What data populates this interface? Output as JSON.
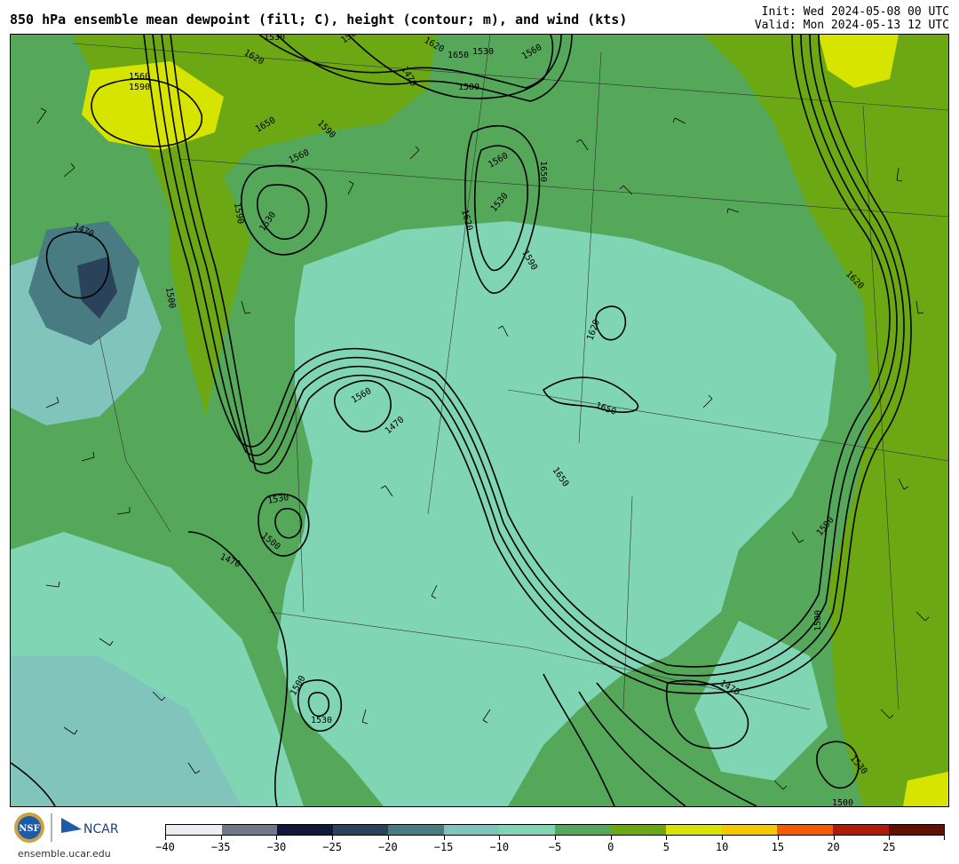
{
  "header": {
    "title": "850 hPa ensemble mean dewpoint (fill; C), height (contour; m), and wind (kts)",
    "init": "Init: Wed 2024-05-08 00 UTC",
    "valid": "Valid: Mon 2024-05-13 12 UTC"
  },
  "footer": {
    "logo_nsf": "NSF",
    "logo_ncar": "NCAR",
    "site": "ensemble.ucar.edu"
  },
  "colorbar": {
    "colors": [
      "#ececf2",
      "#6e7a8a",
      "#10193a",
      "#2a435a",
      "#487c82",
      "#80c4bc",
      "#7fd5b4",
      "#55a85a",
      "#6ba814",
      "#d6e400",
      "#f5c800",
      "#f55a00",
      "#b01a08",
      "#621000"
    ],
    "ticks": [
      "-40",
      "-35",
      "-30",
      "-25",
      "-20",
      "-15",
      "-10",
      "-5",
      "0",
      "5",
      "10",
      "15",
      "20",
      "25"
    ]
  },
  "map": {
    "contour_labels": [
      {
        "text": "1530"
      },
      {
        "text": "1560"
      },
      {
        "text": "1590"
      },
      {
        "text": "1620"
      },
      {
        "text": "1650"
      },
      {
        "text": "1590"
      },
      {
        "text": "1500"
      },
      {
        "text": "1470"
      },
      {
        "text": "1560"
      },
      {
        "text": "1530"
      },
      {
        "text": "1590"
      },
      {
        "text": "1500"
      },
      {
        "text": "1620"
      },
      {
        "text": "1650"
      },
      {
        "text": "1560"
      },
      {
        "text": "1470"
      },
      {
        "text": "1530"
      },
      {
        "text": "1500"
      },
      {
        "text": "1560"
      },
      {
        "text": "1470"
      },
      {
        "text": "1500"
      },
      {
        "text": "1530"
      },
      {
        "text": "1530"
      },
      {
        "text": "1470"
      },
      {
        "text": "1500"
      },
      {
        "text": "1590"
      },
      {
        "text": "1620"
      },
      {
        "text": "1650"
      },
      {
        "text": "1650"
      },
      {
        "text": "1560"
      },
      {
        "text": "1530"
      },
      {
        "text": "1500"
      },
      {
        "text": "1470"
      },
      {
        "text": "1620"
      },
      {
        "text": "1650"
      },
      {
        "text": "1620"
      },
      {
        "text": "1590"
      },
      {
        "text": "1530"
      },
      {
        "text": "1500"
      }
    ]
  }
}
